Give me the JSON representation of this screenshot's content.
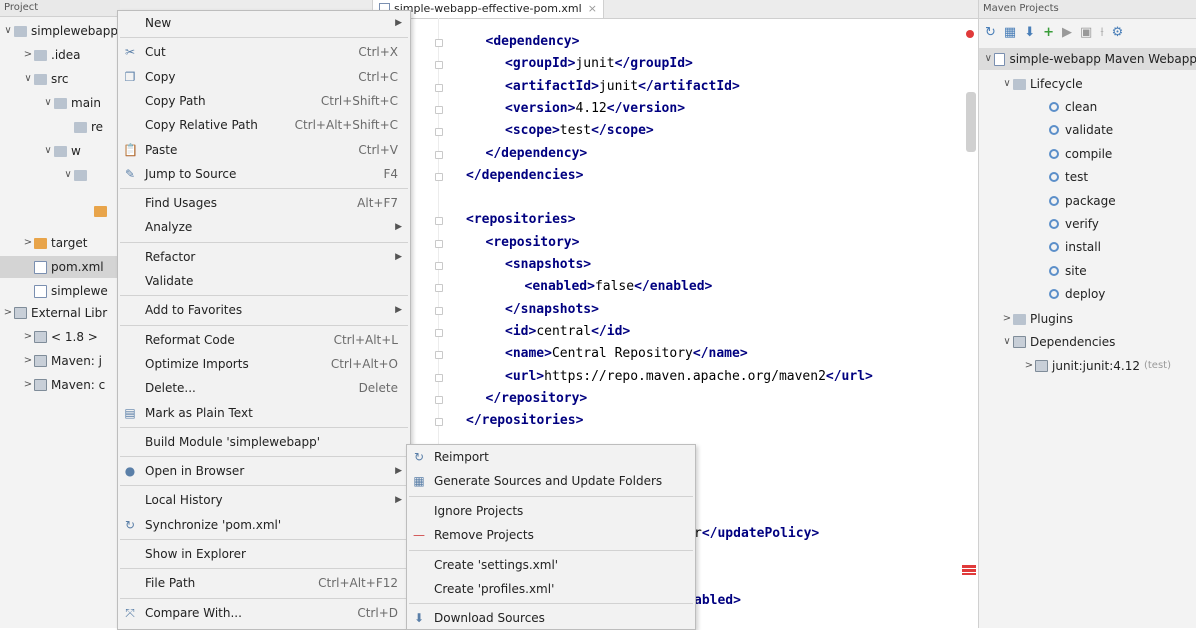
{
  "project_panel": {
    "header": "Project",
    "tree": [
      {
        "label": "simplewebapp",
        "arrow": "∨",
        "indent": 0,
        "icon": "folder"
      },
      {
        "label": ".idea",
        "arrow": ">",
        "indent": 1,
        "icon": "folder"
      },
      {
        "label": "src",
        "arrow": "∨",
        "indent": 1,
        "icon": "folder"
      },
      {
        "label": "main",
        "arrow": "∨",
        "indent": 2,
        "icon": "folder"
      },
      {
        "label": "re",
        "arrow": "",
        "indent": 3,
        "icon": "folder"
      },
      {
        "label": "w",
        "arrow": "∨",
        "indent": 2,
        "icon": "folder"
      },
      {
        "label": "",
        "arrow": "∨",
        "indent": 3,
        "icon": "folder"
      },
      {
        "label": "",
        "arrow": "",
        "indent": 4,
        "icon": "orange"
      },
      {
        "label": "target",
        "arrow": ">",
        "indent": 1,
        "icon": "orange"
      },
      {
        "label": "pom.xml",
        "arrow": "",
        "indent": 1,
        "icon": "xml",
        "selected": true
      },
      {
        "label": "simplewe",
        "arrow": "",
        "indent": 1,
        "icon": "xml"
      },
      {
        "label": "External Libr",
        "arrow": ">",
        "indent": 0,
        "icon": "lib"
      },
      {
        "label": "< 1.8 >",
        "arrow": ">",
        "indent": 1,
        "icon": "lib"
      },
      {
        "label": "Maven: j",
        "arrow": ">",
        "indent": 1,
        "icon": "lib"
      },
      {
        "label": "Maven: c",
        "arrow": ">",
        "indent": 1,
        "icon": "lib"
      }
    ]
  },
  "editor": {
    "tab_title": "simple-webapp-effective-pom.xml",
    "lines": [
      {
        "indent": 1,
        "parts": [
          [
            "t",
            "<dependency>"
          ]
        ]
      },
      {
        "indent": 2,
        "parts": [
          [
            "t",
            "<groupId>"
          ],
          [
            "x",
            "junit"
          ],
          [
            "t",
            "</groupId>"
          ]
        ]
      },
      {
        "indent": 2,
        "parts": [
          [
            "t",
            "<artifactId>"
          ],
          [
            "x",
            "junit"
          ],
          [
            "t",
            "</artifactId>"
          ]
        ]
      },
      {
        "indent": 2,
        "parts": [
          [
            "t",
            "<version>"
          ],
          [
            "x",
            "4.12"
          ],
          [
            "t",
            "</version>"
          ]
        ]
      },
      {
        "indent": 2,
        "parts": [
          [
            "t",
            "<scope>"
          ],
          [
            "x",
            "test"
          ],
          [
            "t",
            "</scope>"
          ]
        ]
      },
      {
        "indent": 1,
        "parts": [
          [
            "t",
            "</dependency>"
          ]
        ]
      },
      {
        "indent": 0,
        "parts": [
          [
            "t",
            "</dependencies>"
          ]
        ]
      },
      {
        "indent": 0,
        "parts": []
      },
      {
        "indent": 0,
        "parts": [
          [
            "t",
            "<repositories>"
          ]
        ]
      },
      {
        "indent": 1,
        "parts": [
          [
            "t",
            "<repository>"
          ]
        ]
      },
      {
        "indent": 2,
        "parts": [
          [
            "t",
            "<snapshots>"
          ]
        ]
      },
      {
        "indent": 3,
        "parts": [
          [
            "t",
            "<enabled>"
          ],
          [
            "x",
            "false"
          ],
          [
            "t",
            "</enabled>"
          ]
        ]
      },
      {
        "indent": 2,
        "parts": [
          [
            "t",
            "</snapshots>"
          ]
        ]
      },
      {
        "indent": 2,
        "parts": [
          [
            "t",
            "<id>"
          ],
          [
            "x",
            "central"
          ],
          [
            "t",
            "</id>"
          ]
        ]
      },
      {
        "indent": 2,
        "parts": [
          [
            "t",
            "<name>"
          ],
          [
            "x",
            "Central Repository"
          ],
          [
            "t",
            "</name>"
          ]
        ]
      },
      {
        "indent": 2,
        "parts": [
          [
            "t",
            "<url>"
          ],
          [
            "x",
            "https://repo.maven.apache.org/maven2"
          ],
          [
            "t",
            "</url>"
          ]
        ]
      },
      {
        "indent": 1,
        "parts": [
          [
            "t",
            "</repository>"
          ]
        ]
      },
      {
        "indent": 0,
        "parts": [
          [
            "t",
            "</repositories>"
          ]
        ]
      }
    ],
    "partial_lines": [
      {
        "text": "r</updatePolicy>",
        "tag_from": 1
      },
      {
        "text": "abled>",
        "tag_from": 0
      }
    ]
  },
  "maven_panel": {
    "header": "Maven Projects",
    "project": "simple-webapp Maven Webapp",
    "lifecycle_label": "Lifecycle",
    "lifecycle_goals": [
      "clean",
      "validate",
      "compile",
      "test",
      "package",
      "verify",
      "install",
      "site",
      "deploy"
    ],
    "plugins_label": "Plugins",
    "dependencies_label": "Dependencies",
    "dependency_item": "junit:junit:4.12",
    "dependency_scope": "(test)"
  },
  "context_menu": {
    "items": [
      {
        "label": "New",
        "submenu": true
      },
      {
        "sep": true
      },
      {
        "label": "Cut",
        "shortcut": "Ctrl+X",
        "icon": "scissors-icon",
        "glyph": "✂"
      },
      {
        "label": "Copy",
        "shortcut": "Ctrl+C",
        "icon": "copy-icon",
        "glyph": "❐"
      },
      {
        "label": "Copy Path",
        "shortcut": "Ctrl+Shift+C"
      },
      {
        "label": "Copy Relative Path",
        "shortcut": "Ctrl+Alt+Shift+C"
      },
      {
        "label": "Paste",
        "shortcut": "Ctrl+V",
        "icon": "paste-icon",
        "glyph": "📋"
      },
      {
        "label": "Jump to Source",
        "shortcut": "F4",
        "icon": "edit-icon",
        "glyph": "✎"
      },
      {
        "sep": true
      },
      {
        "label": "Find Usages",
        "shortcut": "Alt+F7"
      },
      {
        "label": "Analyze",
        "submenu": true
      },
      {
        "sep": true
      },
      {
        "label": "Refactor",
        "submenu": true
      },
      {
        "label": "Validate"
      },
      {
        "sep": true
      },
      {
        "label": "Add to Favorites",
        "submenu": true
      },
      {
        "sep": true
      },
      {
        "label": "Reformat Code",
        "shortcut": "Ctrl+Alt+L"
      },
      {
        "label": "Optimize Imports",
        "shortcut": "Ctrl+Alt+O"
      },
      {
        "label": "Delete...",
        "shortcut": "Delete"
      },
      {
        "label": "Mark as Plain Text",
        "icon": "plain-text-icon",
        "glyph": "▤"
      },
      {
        "sep": true
      },
      {
        "label": "Build Module 'simplewebapp'"
      },
      {
        "sep": true
      },
      {
        "label": "Open in Browser",
        "submenu": true,
        "icon": "globe-icon",
        "glyph": "●"
      },
      {
        "sep": true
      },
      {
        "label": "Local History",
        "submenu": true
      },
      {
        "label": "Synchronize 'pom.xml'",
        "icon": "sync-icon",
        "glyph": "↻"
      },
      {
        "sep": true
      },
      {
        "label": "Show in Explorer"
      },
      {
        "sep": true
      },
      {
        "label": "File Path",
        "shortcut": "Ctrl+Alt+F12"
      },
      {
        "sep": true
      },
      {
        "label": "Compare With...",
        "shortcut": "Ctrl+D",
        "icon": "compare-icon",
        "glyph": "⤧"
      }
    ]
  },
  "maven_submenu": {
    "items": [
      {
        "label": "Reimport",
        "icon": "reimport-icon",
        "glyph": "↻"
      },
      {
        "label": "Generate Sources and Update Folders",
        "icon": "generate-sources-icon",
        "glyph": "▦"
      },
      {
        "sep": true
      },
      {
        "label": "Ignore Projects"
      },
      {
        "label": "Remove Projects",
        "icon": "remove-icon",
        "glyph": "—",
        "color": "#d04a4a"
      },
      {
        "sep": true
      },
      {
        "label": "Create 'settings.xml'"
      },
      {
        "label": "Create 'profiles.xml'"
      },
      {
        "sep": true
      },
      {
        "label": "Download Sources",
        "icon": "download-icon",
        "glyph": "⬇"
      }
    ]
  }
}
